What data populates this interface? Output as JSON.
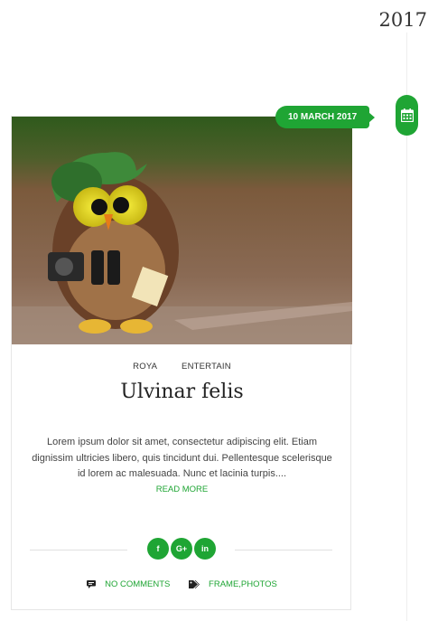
{
  "timeline": {
    "year": "2017"
  },
  "post": {
    "date": "10 MARCH 2017",
    "categories": [
      "ROYA",
      "ENTERTAIN"
    ],
    "title": "Ulvinar felis",
    "excerpt": "Lorem ipsum dolor sit amet, consectetur adipiscing elit. Etiam dignissim ultricies libero, quis tincidunt dui. Pellentesque scelerisque id lorem ac malesuada. Nunc et lacinia turpis....",
    "read_more": "READ MORE",
    "share": {
      "facebook": "f",
      "google": "G+",
      "linkedin": "in"
    },
    "comments": "NO COMMENTS",
    "tags": "FRAME,PHOTOS"
  },
  "colors": {
    "accent": "#1fa534"
  },
  "icons": [
    "calendar-icon",
    "comment-icon",
    "tag-icon",
    "facebook-icon",
    "google-plus-icon",
    "linkedin-icon"
  ]
}
